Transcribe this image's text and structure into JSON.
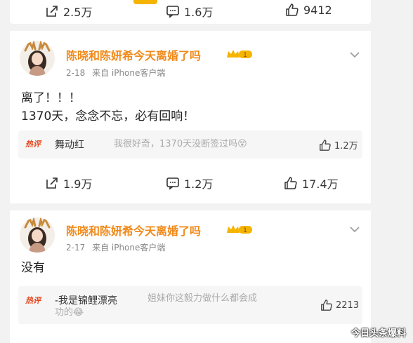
{
  "topbar": {
    "share_count": "2.5万",
    "comment_count": "1.6万",
    "like_count": "9412"
  },
  "posts": [
    {
      "username": "陈晓和陈妍希今天离婚了吗",
      "date": "2-18",
      "source": "来自 iPhone客户端",
      "content_lines": [
        "离了！！！",
        "1370天，念念不忘，必有回响！"
      ],
      "hot_label": "热评",
      "comment_user": "舞动红",
      "comment_text": "我很好奇，1370天没断签过吗😵",
      "comment_likes": "1.2万",
      "share_count": "1.9万",
      "comment_count": "1.2万",
      "like_count": "17.4万"
    },
    {
      "username": "陈晓和陈妍希今天离婚了吗",
      "date": "2-17",
      "source": "来自 iPhone客户端",
      "content_lines": [
        "没有"
      ],
      "hot_label": "热评",
      "comment_user": "-我是锦鲤漂亮",
      "comment_text_line1": "姐妹你这毅力做什么都会成",
      "comment_text_line2": "功的😂",
      "comment_likes": "2213"
    }
  ],
  "watermark": "今日头条爆料",
  "icons": [
    "share-icon",
    "comment-icon",
    "like-icon",
    "vip-crown-icon",
    "chevron-down-icon"
  ],
  "colors": {
    "username": "#f08a1a",
    "hot_label": "#e3461e",
    "vip": "#f5b400"
  }
}
